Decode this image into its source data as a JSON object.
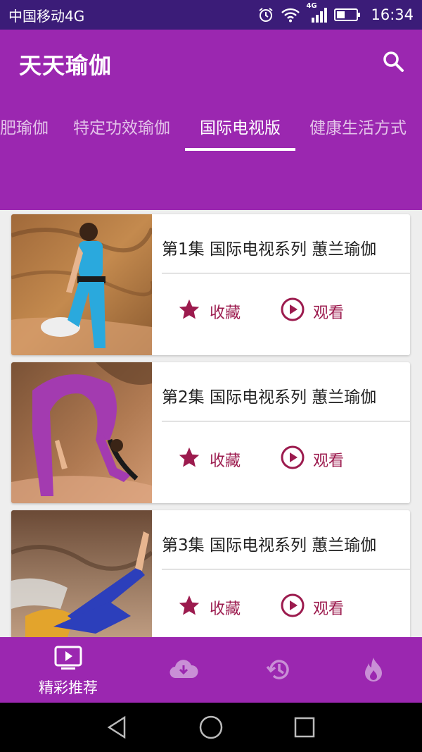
{
  "status_bar": {
    "carrier": "中国移动4G",
    "network": "4G",
    "time": "16:34"
  },
  "app_bar": {
    "title": "天天瑜伽",
    "search_icon": "search-icon"
  },
  "tabs": [
    {
      "label": "肥瑜伽",
      "active": false
    },
    {
      "label": "特定功效瑜伽",
      "active": false
    },
    {
      "label": "国际电视版",
      "active": true
    },
    {
      "label": "健康生活方式",
      "active": false
    }
  ],
  "episodes": [
    {
      "title": "第1集 国际电视系列 蕙兰瑜伽",
      "favorite_label": "收藏",
      "watch_label": "观看"
    },
    {
      "title": "第2集 国际电视系列 蕙兰瑜伽",
      "favorite_label": "收藏",
      "watch_label": "观看"
    },
    {
      "title": "第3集 国际电视系列 蕙兰瑜伽",
      "favorite_label": "收藏",
      "watch_label": "观看"
    }
  ],
  "bottom_nav": [
    {
      "label": "精彩推荐",
      "icon": "tv-play-icon",
      "active": true
    },
    {
      "label": "",
      "icon": "cloud-download-icon",
      "active": false
    },
    {
      "label": "",
      "icon": "history-icon",
      "active": false
    },
    {
      "label": "",
      "icon": "flame-icon",
      "active": false
    }
  ],
  "colors": {
    "status_bar": "#3b1c78",
    "primary": "#9b27b0",
    "accent": "#9c1b4e",
    "nav_inactive": "#c98fd6"
  }
}
